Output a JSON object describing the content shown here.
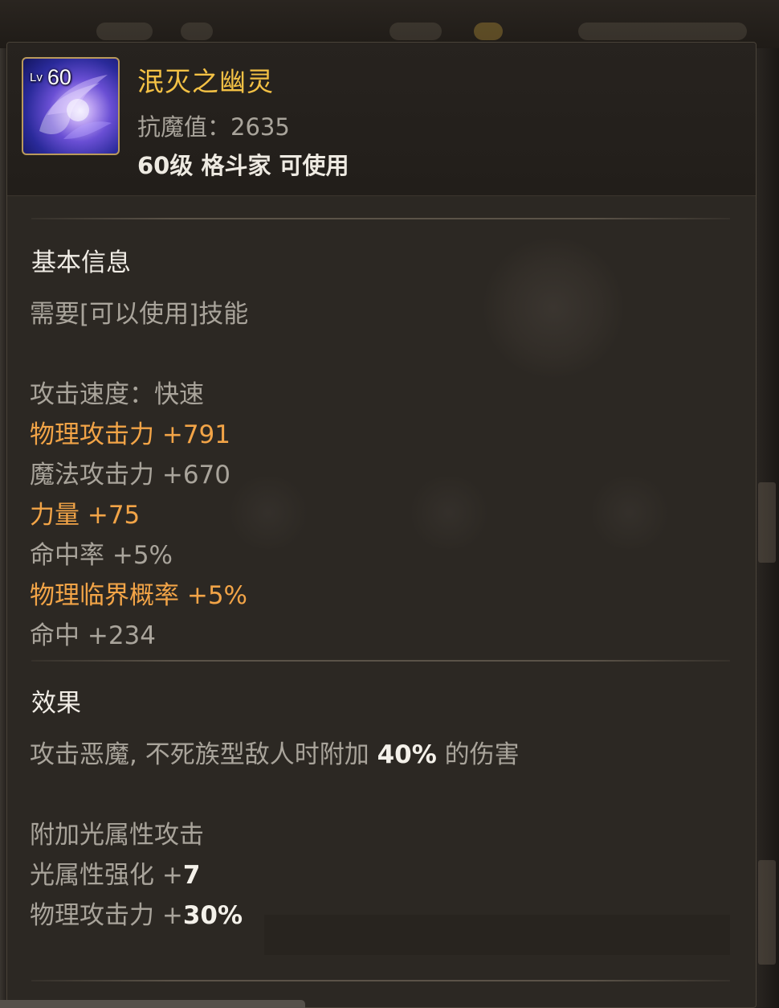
{
  "item": {
    "level_prefix": "Lv",
    "level": "60",
    "name": "泯灭之幽灵",
    "resist": "抗魔值：2635",
    "usable": "60级 格斗家 可使用",
    "icon": "purple-spirit-flame-icon"
  },
  "basic": {
    "title": "基本信息",
    "requirement": "需要[可以使用]技能",
    "attack_speed": "攻击速度：快速",
    "stats": [
      {
        "label": "物理攻击力 +791",
        "highlight": true
      },
      {
        "label": "魔法攻击力 +670",
        "highlight": false
      },
      {
        "label": "力量 +75",
        "highlight": true
      },
      {
        "label": "命中率 +5%",
        "highlight": false
      },
      {
        "label": "物理临界概率 +5%",
        "highlight": true
      },
      {
        "label": "命中 +234",
        "highlight": false
      }
    ]
  },
  "effect": {
    "title": "效果",
    "line1_prefix": "攻击恶魔, 不死族型敌人时附加 ",
    "line1_value": "40%",
    "line1_suffix": " 的伤害",
    "line2": "附加光属性攻击",
    "line3_prefix": "光属性强化 +",
    "line3_value": "7",
    "line4_prefix": "物理攻击力 +",
    "line4_value": "30%"
  },
  "colors": {
    "name": "#f3c145",
    "highlight": "#f2a447",
    "normal": "#a9a49b",
    "bright": "#f4f1ea"
  }
}
